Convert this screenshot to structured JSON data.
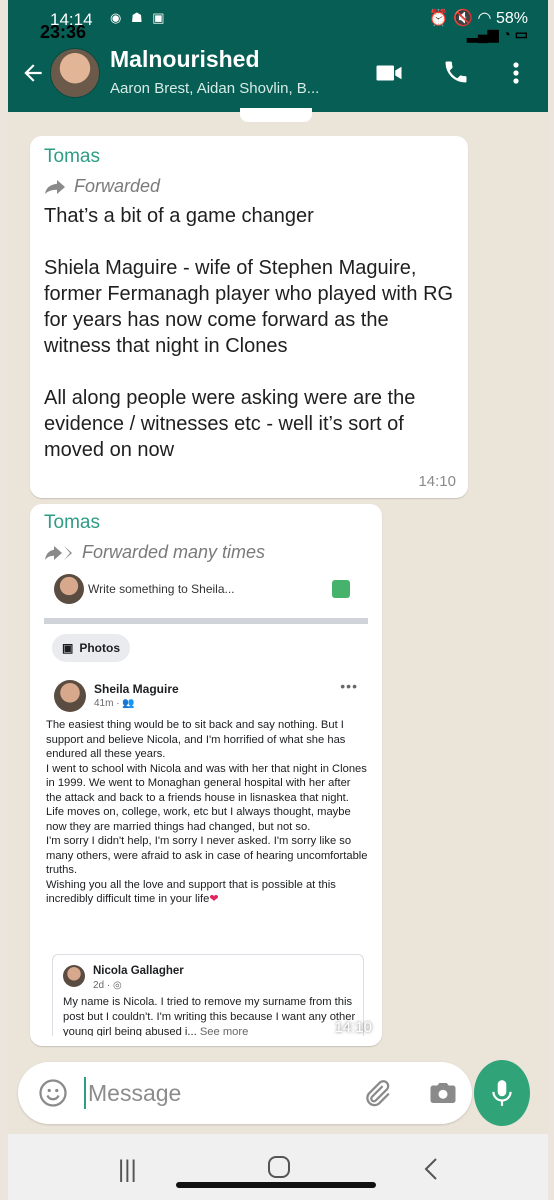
{
  "status_bar": {
    "time_primary": "14:14",
    "time_secondary": "23:36",
    "battery": "58%"
  },
  "header": {
    "title": "Malnourished",
    "subtitle": "Aaron Brest, Aidan Shovlin, B...",
    "icons": [
      "back-arrow-icon",
      "video-call-icon",
      "phone-icon",
      "more-vert-icon"
    ]
  },
  "messages": [
    {
      "sender": "Tomas",
      "forward_label": "Forwarded",
      "text": "That’s a bit of a game changer\n\nShiela Maguire - wife of Stephen Maguire, former Fermanagh player who played with RG for years has now come forward as the witness that night in Clones\n\nAll along people were asking were are the evidence / witnesses etc - well it’s sort of moved on now",
      "time": "14:10"
    },
    {
      "sender": "Tomas",
      "forward_label": "Forwarded many times",
      "time": "14:10",
      "facebook": {
        "write_prompt": "Write something to Sheila...",
        "photos_label": "Photos",
        "post_author": "Sheila Maguire",
        "post_meta": "41m · ",
        "post_body": "The easiest thing would be to sit back and say nothing. But I support and believe Nicola, and I'm horrified of what she has endured all these years.\nI went to school with Nicola and was with her that night in Clones in 1999. We went to Monaghan general hospital with her after the attack and back to a friends house in lisnaskea that night.\nLife moves on, college, work, etc but I always thought, maybe now they are married things had changed, but not so.\nI'm sorry I didn't help, I'm sorry I never asked. I'm sorry like so many others, were afraid to ask in case of hearing uncomfortable truths.\nWishing you all the love and support that is possible at this incredibly difficult time in your life",
        "shared_author": "Nicola Gallagher",
        "shared_meta": "2d · ",
        "shared_body": "My name is Nicola. I tried to remove my surname from this post but I couldn't. I'm writing this because I want any other young girl being abused i...",
        "see_more": "See more"
      }
    }
  ],
  "composer": {
    "placeholder": "Message"
  },
  "colors": {
    "header": "#075e54",
    "sender_name": "#2f9c86",
    "mic_button": "#31a379",
    "chat_background": "#ebe4d9"
  }
}
